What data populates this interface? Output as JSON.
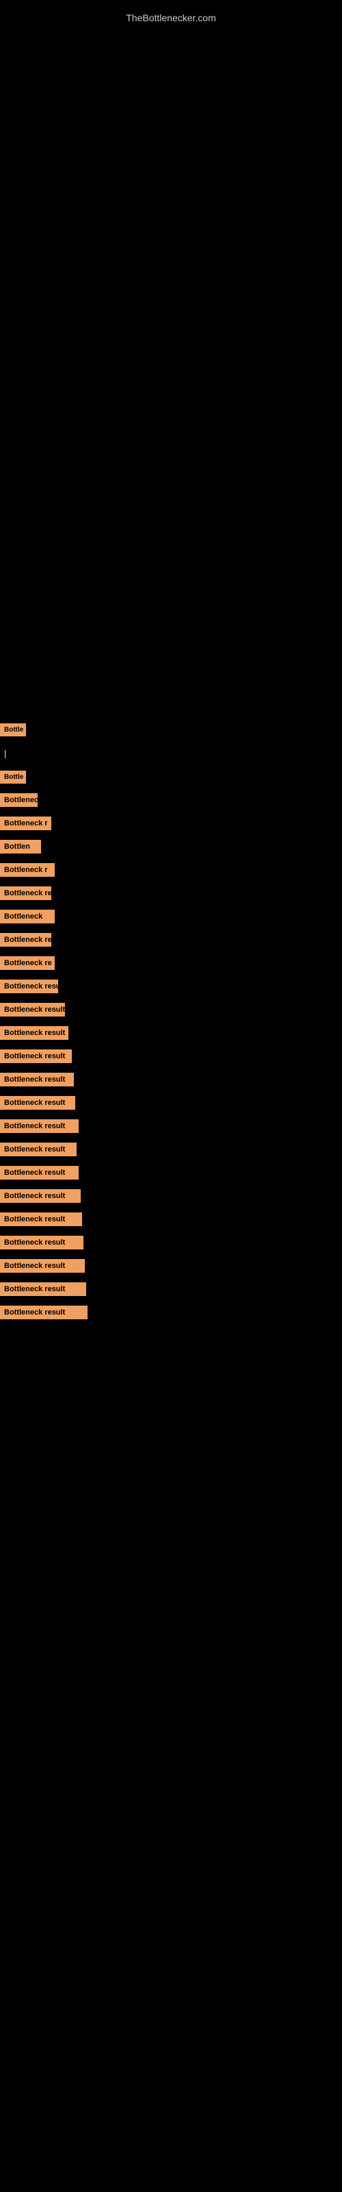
{
  "site": {
    "title": "TheBottlenecker.com"
  },
  "items": [
    {
      "id": 1,
      "label": "Bottleneck result",
      "class": "item-1"
    },
    {
      "id": 2,
      "label": "|",
      "class": "item-2"
    },
    {
      "id": 3,
      "label": "Bottleneck result",
      "class": "item-3"
    },
    {
      "id": 4,
      "label": "Bottleneck result",
      "class": "item-4"
    },
    {
      "id": 5,
      "label": "Bottleneck result",
      "class": "item-5"
    },
    {
      "id": 6,
      "label": "Bottleneck result",
      "class": "item-6"
    },
    {
      "id": 7,
      "label": "Bottleneck result",
      "class": "item-7"
    },
    {
      "id": 8,
      "label": "Bottleneck result",
      "class": "item-8"
    },
    {
      "id": 9,
      "label": "Bottleneck result",
      "class": "item-9"
    },
    {
      "id": 10,
      "label": "Bottleneck result",
      "class": "item-10"
    },
    {
      "id": 11,
      "label": "Bottleneck result",
      "class": "item-11"
    },
    {
      "id": 12,
      "label": "Bottleneck result",
      "class": "item-12"
    },
    {
      "id": 13,
      "label": "Bottleneck result",
      "class": "item-13"
    },
    {
      "id": 14,
      "label": "Bottleneck result",
      "class": "item-14"
    },
    {
      "id": 15,
      "label": "Bottleneck result",
      "class": "item-15"
    },
    {
      "id": 16,
      "label": "Bottleneck result",
      "class": "item-16"
    },
    {
      "id": 17,
      "label": "Bottleneck result",
      "class": "item-17"
    },
    {
      "id": 18,
      "label": "Bottleneck result",
      "class": "item-18"
    },
    {
      "id": 19,
      "label": "Bottleneck result",
      "class": "item-19"
    },
    {
      "id": 20,
      "label": "Bottleneck result",
      "class": "item-20"
    },
    {
      "id": 21,
      "label": "Bottleneck result",
      "class": "item-21"
    },
    {
      "id": 22,
      "label": "Bottleneck result",
      "class": "item-22"
    },
    {
      "id": 23,
      "label": "Bottleneck result",
      "class": "item-23"
    },
    {
      "id": 24,
      "label": "Bottleneck result",
      "class": "item-24"
    },
    {
      "id": 25,
      "label": "Bottleneck result",
      "class": "item-25"
    },
    {
      "id": 26,
      "label": "Bottleneck result",
      "class": "item-26"
    }
  ],
  "colors": {
    "background": "#000000",
    "label_bg": "#f0a060",
    "label_text": "#000000",
    "title_text": "#cccccc"
  }
}
